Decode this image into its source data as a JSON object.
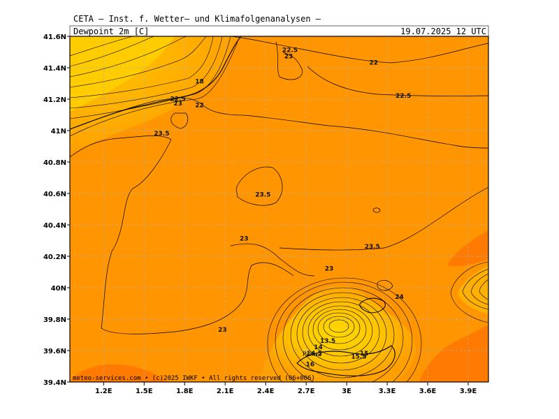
{
  "header": {
    "title": "CETA — Inst. f. Wetter— und Klimafolgenanalysen —",
    "variable": "Dewpoint 2m [C]",
    "valid_time": "19.07.2025 12 UTC"
  },
  "footer": {
    "credit": "meteo-services.com • (c)2025 IWKF • All rights reserved (06+006)"
  },
  "colors": {
    "level_22_23": "#ff9a00",
    "level_23_24": "#ff8c00",
    "level_24_plus": "#ff6f00",
    "level_13_22": "#ffa800",
    "level_lt_13": "#ffd000",
    "level_gt_20_nw": "#ffb400",
    "contour": "#000000",
    "grid": "#b0b0b0"
  },
  "chart_data": {
    "type": "contour-map",
    "title": "Dewpoint 2m [C]",
    "xlabel": "",
    "ylabel": "",
    "xlim": [
      0.95,
      4.05
    ],
    "ylim": [
      39.4,
      41.6
    ],
    "xticks": [
      {
        "value": 1.2,
        "label": "1.2E"
      },
      {
        "value": 1.5,
        "label": "1.5E"
      },
      {
        "value": 1.8,
        "label": "1.8E"
      },
      {
        "value": 2.1,
        "label": "2.1E"
      },
      {
        "value": 2.4,
        "label": "2.4E"
      },
      {
        "value": 2.7,
        "label": "2.7E"
      },
      {
        "value": 3.0,
        "label": "3E"
      },
      {
        "value": 3.3,
        "label": "3.3E"
      },
      {
        "value": 3.6,
        "label": "3.6E"
      },
      {
        "value": 3.9,
        "label": "3.9E"
      }
    ],
    "yticks": [
      {
        "value": 41.6,
        "label": "41.6N"
      },
      {
        "value": 41.4,
        "label": "41.4N"
      },
      {
        "value": 41.2,
        "label": "41.2N"
      },
      {
        "value": 41.0,
        "label": "41N"
      },
      {
        "value": 40.8,
        "label": "40.8N"
      },
      {
        "value": 40.6,
        "label": "40.6N"
      },
      {
        "value": 40.4,
        "label": "40.4N"
      },
      {
        "value": 40.2,
        "label": "40.2N"
      },
      {
        "value": 40.0,
        "label": "40N"
      },
      {
        "value": 39.8,
        "label": "39.8N"
      },
      {
        "value": 39.6,
        "label": "39.6N"
      },
      {
        "value": 39.4,
        "label": "39.4N"
      }
    ],
    "grid": true,
    "contour_interval": 0.5,
    "contour_labels": [
      {
        "value": "22.5",
        "lon": 2.58,
        "lat": 41.5
      },
      {
        "value": "23",
        "lon": 2.57,
        "lat": 41.46
      },
      {
        "value": "22",
        "lon": 3.2,
        "lat": 41.42
      },
      {
        "value": "22.5",
        "lon": 3.42,
        "lat": 41.21
      },
      {
        "value": "18",
        "lon": 1.91,
        "lat": 41.3
      },
      {
        "value": "22.5",
        "lon": 1.75,
        "lat": 41.19
      },
      {
        "value": "23",
        "lon": 1.75,
        "lat": 41.16
      },
      {
        "value": "22",
        "lon": 1.91,
        "lat": 41.15
      },
      {
        "value": "23.5",
        "lon": 1.63,
        "lat": 40.97
      },
      {
        "value": "23.5",
        "lon": 2.38,
        "lat": 40.58
      },
      {
        "value": "23",
        "lon": 2.24,
        "lat": 40.3
      },
      {
        "value": "23.5",
        "lon": 3.19,
        "lat": 40.25
      },
      {
        "value": "23",
        "lon": 2.87,
        "lat": 40.11
      },
      {
        "value": "24",
        "lon": 3.39,
        "lat": 39.93
      },
      {
        "value": "23",
        "lon": 2.08,
        "lat": 39.72
      },
      {
        "value": "13.5",
        "lon": 2.86,
        "lat": 39.65
      },
      {
        "value": "14",
        "lon": 2.79,
        "lat": 39.61
      },
      {
        "value": "14.5",
        "lon": 2.76,
        "lat": 39.57
      },
      {
        "value": "15",
        "lon": 3.13,
        "lat": 39.57
      },
      {
        "value": "15.5",
        "lon": 3.09,
        "lat": 39.55
      },
      {
        "value": "16",
        "lon": 2.73,
        "lat": 39.5
      }
    ],
    "regions": [
      {
        "name": "nw-low",
        "level": "level_gt_20_nw"
      },
      {
        "name": "mallorca-low",
        "level": "level_lt_13"
      },
      {
        "name": "menorca-high",
        "level": "level_24_plus"
      }
    ],
    "place_labels": [
      "Palma"
    ]
  }
}
